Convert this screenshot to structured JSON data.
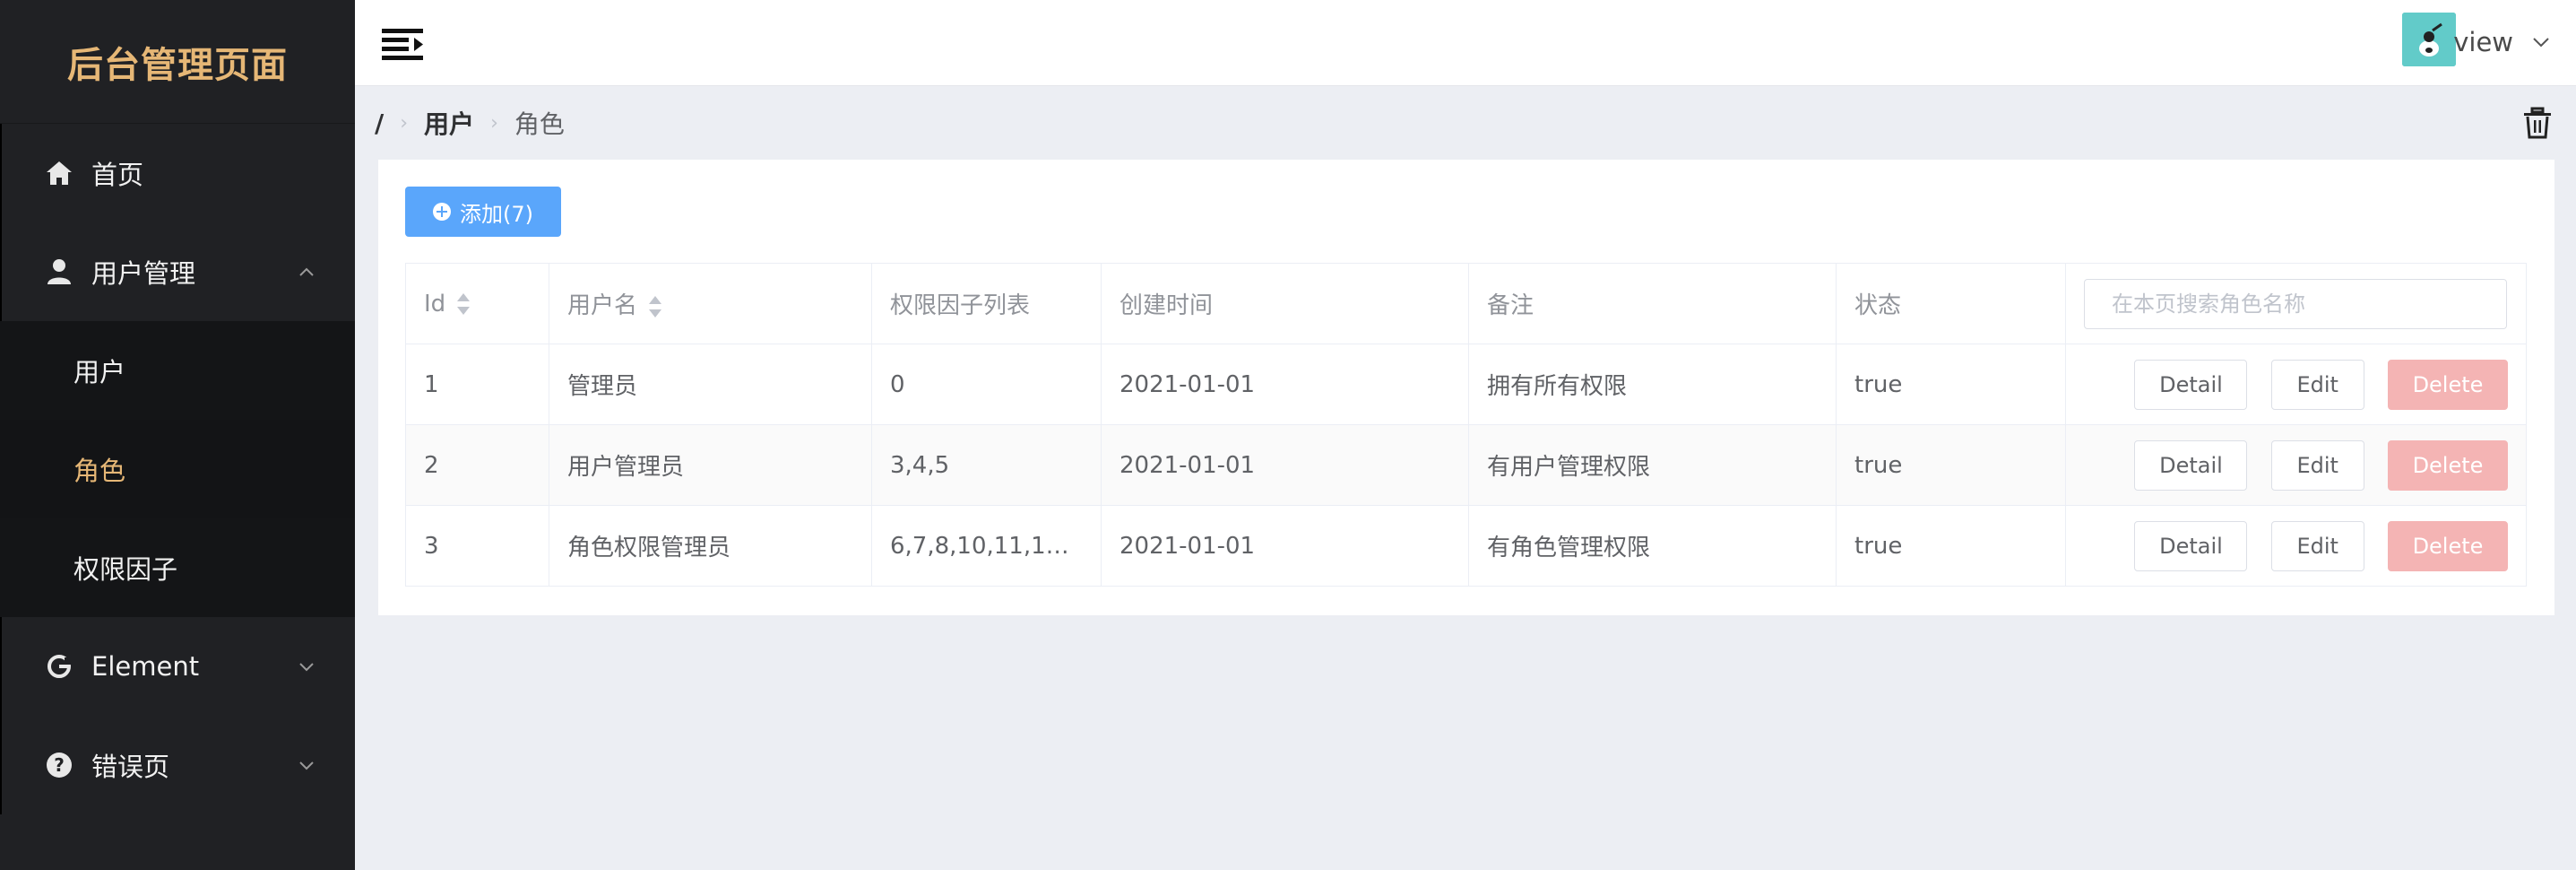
{
  "brand": {
    "title": "后台管理页面"
  },
  "sidebar": {
    "items": [
      {
        "label": "首页",
        "icon": "home-icon"
      },
      {
        "label": "用户管理",
        "icon": "user-icon",
        "expanded": true,
        "children": [
          {
            "label": "用户",
            "active": false
          },
          {
            "label": "角色",
            "active": true
          },
          {
            "label": "权限因子",
            "active": false
          }
        ]
      },
      {
        "label": "Element",
        "icon": "element-icon"
      },
      {
        "label": "错误页",
        "icon": "help-icon"
      }
    ]
  },
  "header": {
    "user_name": "view"
  },
  "breadcrumb": {
    "root": "/",
    "level1": "用户",
    "level2": "角色"
  },
  "toolbar": {
    "add_label": "添加(7)"
  },
  "table": {
    "headers": {
      "id": "Id",
      "username": "用户名",
      "perms": "权限因子列表",
      "created": "创建时间",
      "remark": "备注",
      "status": "状态"
    },
    "search_placeholder": "在本页搜索角色名称",
    "rows": [
      {
        "id": "1",
        "username": "管理员",
        "perms": "0",
        "created": "2021-01-01",
        "remark": "拥有所有权限",
        "status": "true"
      },
      {
        "id": "2",
        "username": "用户管理员",
        "perms": "3,4,5",
        "created": "2021-01-01",
        "remark": "有用户管理权限",
        "status": "true"
      },
      {
        "id": "3",
        "username": "角色权限管理员",
        "perms": "6,7,8,10,11,12,13,1...",
        "created": "2021-01-01",
        "remark": "有角色管理权限",
        "status": "true"
      }
    ],
    "actions": {
      "detail": "Detail",
      "edit": "Edit",
      "delete": "Delete"
    }
  },
  "colors": {
    "accent": "#5aa6fb",
    "brand": "#e6b776",
    "sidebar_bg": "#202124",
    "delete": "#f4b4b4"
  }
}
